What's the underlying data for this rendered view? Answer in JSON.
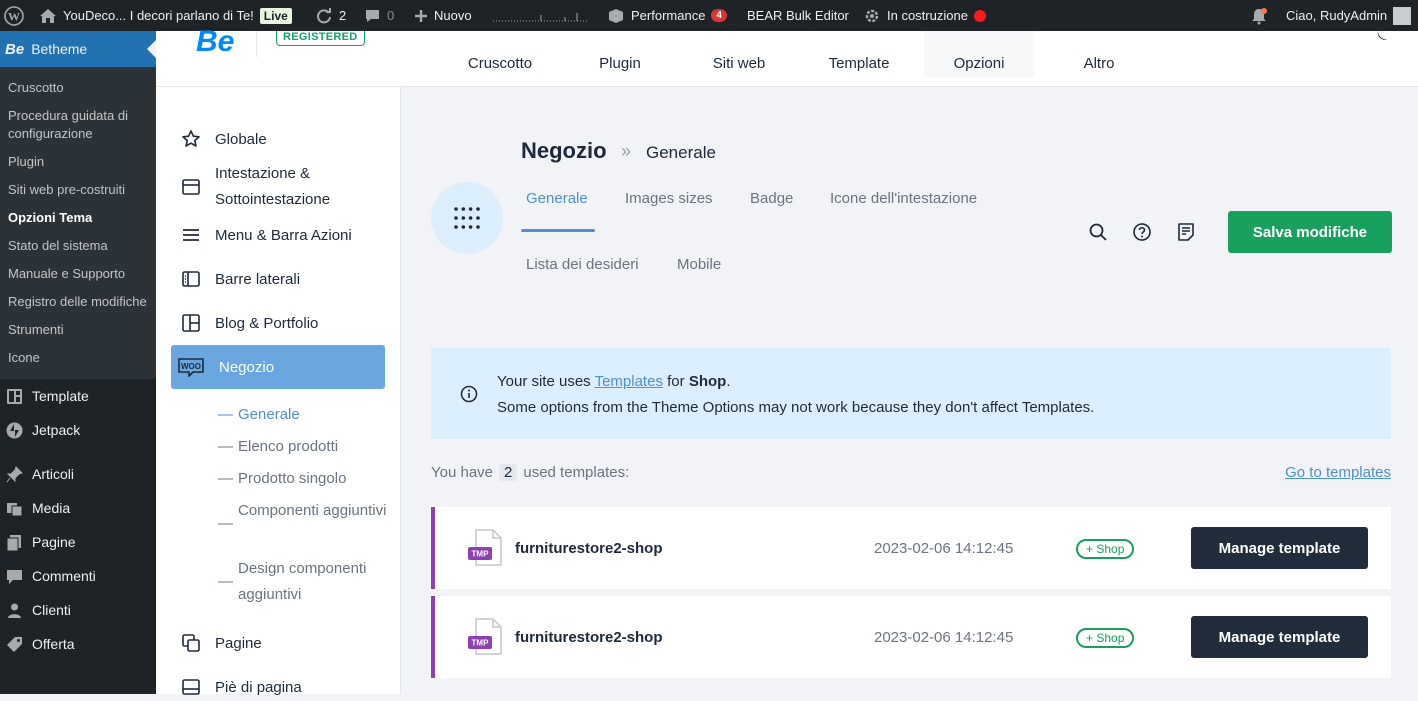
{
  "adminbar": {
    "site_name": "YouDeco... I decori parlano di Te!",
    "live_badge": "Live",
    "updates_count": "2",
    "comments_count": "0",
    "new_label": "Nuovo",
    "performance_label": "Performance",
    "performance_count": "4",
    "bear_label": "BEAR Bulk Editor",
    "construction_label": "In costruzione",
    "greeting": "Ciao, RudyAdmin"
  },
  "wp_menu": {
    "current": "Betheme",
    "current_logo": "Be",
    "submenu": [
      "Cruscotto",
      "Procedura guidata di configurazione",
      "Plugin",
      "Siti web pre-costruiti",
      "Opzioni Tema",
      "Stato del sistema",
      "Manuale e Supporto",
      "Registro delle modifiche",
      "Strumenti",
      "Icone"
    ],
    "submenu_active": "Opzioni Tema",
    "items": [
      {
        "label": "Template",
        "icon": "wordpress-icon"
      },
      {
        "label": "Jetpack",
        "icon": "jetpack-icon"
      },
      {
        "label": "Articoli",
        "icon": "pin-icon"
      },
      {
        "label": "Media",
        "icon": "media-icon"
      },
      {
        "label": "Pagine",
        "icon": "pages-icon"
      },
      {
        "label": "Commenti",
        "icon": "comment-icon"
      },
      {
        "label": "Clienti",
        "icon": "user-icon"
      },
      {
        "label": "Offerta",
        "icon": "tag-icon"
      }
    ]
  },
  "betheme_header": {
    "logo": "Be",
    "registered": "REGISTERED",
    "nav": [
      "Cruscotto",
      "Plugin",
      "Siti web",
      "Template",
      "Opzioni",
      "Altro"
    ],
    "nav_active": "Opzioni"
  },
  "betheme_nav": {
    "items": [
      "Globale",
      "Intestazione & Sottointestazione",
      "Menu & Barra Azioni",
      "Barre laterali",
      "Blog & Portfolio",
      "Negozio",
      "Pagine",
      "Piè di pagina"
    ],
    "active": "Negozio",
    "subitems": [
      "Generale",
      "Elenco prodotti",
      "Prodotto singolo",
      "Componenti aggiuntivi",
      "Design componenti aggiuntivi"
    ],
    "sub_active": "Generale"
  },
  "main": {
    "breadcrumb_title": "Negozio",
    "breadcrumb_sep": "»",
    "breadcrumb_sub": "Generale",
    "tabs": [
      "Generale",
      "Images sizes",
      "Badge",
      "Icone dell'intestazione",
      "Lista dei desideri",
      "Mobile"
    ],
    "tab_active": "Generale",
    "save_button": "Salva modifiche",
    "notice": {
      "line1_prefix": "Your site uses",
      "line1_link": "Templates",
      "line1_mid": "for",
      "line1_bold": "Shop",
      "line1_suffix": ".",
      "line2": "Some options from the Theme Options may not work because they don't affect Templates."
    },
    "used_prefix": "You have",
    "used_count": "2",
    "used_suffix": "used templates:",
    "goto_link": "Go to templates",
    "templates": [
      {
        "icon_label": "TMP",
        "name": "furniturestore2-shop",
        "date": "2023-02-06 14:12:45",
        "tag": "+ Shop",
        "button": "Manage template"
      },
      {
        "icon_label": "TMP",
        "name": "furniturestore2-shop",
        "date": "2023-02-06 14:12:45",
        "tag": "+ Shop",
        "button": "Manage template"
      }
    ]
  },
  "colors": {
    "wp_dark": "#1d2327",
    "wp_blue": "#2271b1",
    "be_blue": "#0089f7",
    "accent_blue": "#4f90d2",
    "active_nav": "#6aa6e0",
    "save_green": "#19a05e",
    "template_purple": "#8f3fb0",
    "dark_button": "#212d3b"
  }
}
